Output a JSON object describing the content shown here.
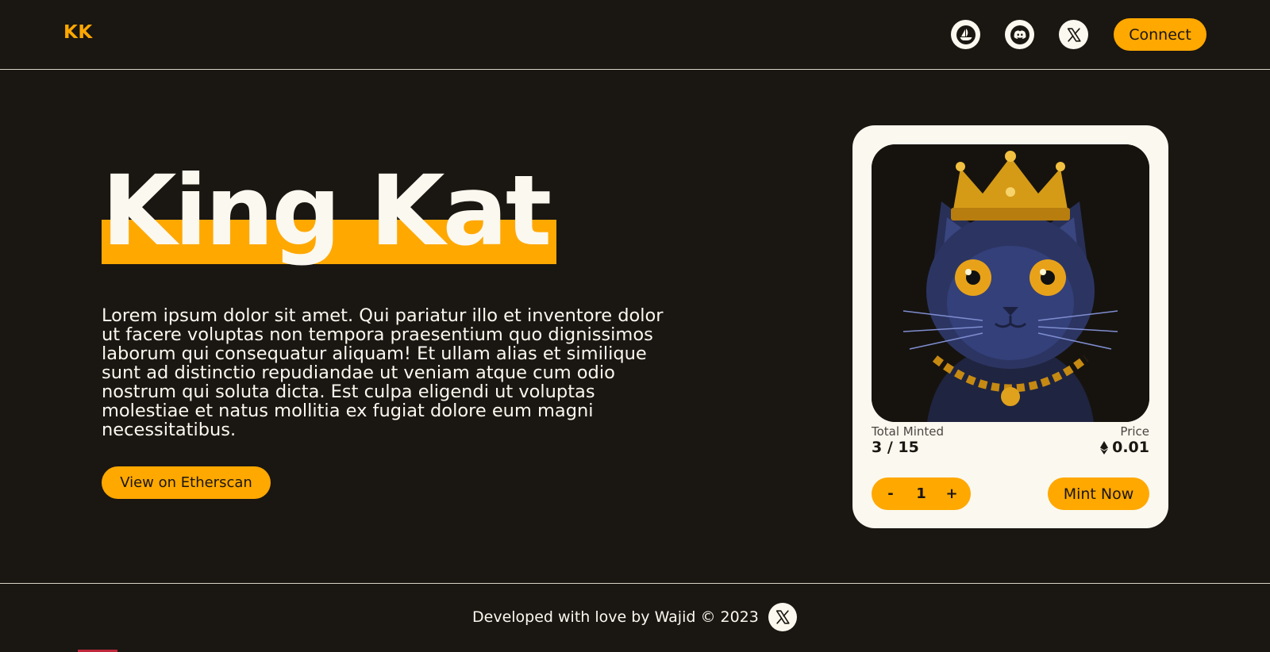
{
  "header": {
    "logo": "KK",
    "social_icons": [
      "opensea-icon",
      "discord-icon",
      "x-icon"
    ],
    "connect_label": "Connect"
  },
  "hero": {
    "title": "King Kat",
    "description": "Lorem ipsum dolor sit amet. Qui pariatur illo et inventore dolor ut facere voluptas non tempora praesentium quo dignissimos laborum qui consequatur aliquam! Et ullam alias et similique sunt ad distinctio repudiandae ut veniam atque cum odio nostrum qui soluta dicta. Est culpa eligendi ut voluptas molestiae et natus mollitia ex fugiat dolore eum magni necessitatibus.",
    "etherscan_label": "View on Etherscan"
  },
  "mint_card": {
    "total_minted_label": "Total Minted",
    "total_minted_value": "3 / 15",
    "price_label": "Price",
    "price_value": "0.01",
    "price_icon": "ethereum-icon",
    "decrement_label": "-",
    "quantity": "1",
    "increment_label": "+",
    "mint_label": "Mint Now"
  },
  "footer": {
    "text": "Developed with love by Wajid © 2023",
    "social_icon": "x-icon"
  },
  "colors": {
    "background": "#1a1612",
    "accent": "#ffa800",
    "light": "#fbf8ef"
  }
}
